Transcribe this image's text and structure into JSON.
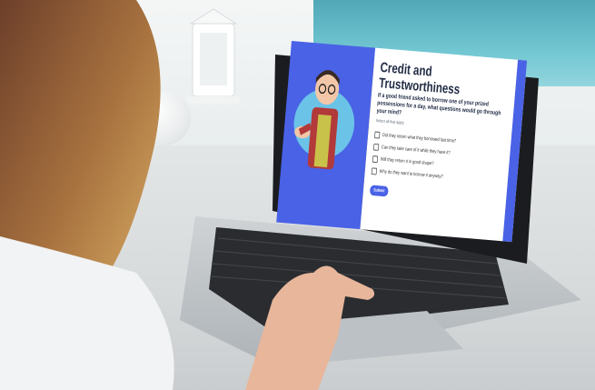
{
  "app": {
    "title": "Credit and Trustworthiness",
    "question": "If a good friend asked to borrow one of your prized possessions for a day, what questions would go through your mind?",
    "hint": "Select all that apply",
    "options": [
      "Did they return what they borrowed last time?",
      "Can they take care of it while they have it?",
      "Will they return it in good shape?",
      "Why do they want to borrow it anyway?"
    ],
    "submit_label": "Submit"
  },
  "colors": {
    "accent": "#4a62e6",
    "panel_bg": "#ffffff",
    "title_text": "#1f2a44"
  },
  "icons": {
    "illustration": "person-offering-hand-illustration",
    "checkbox": "checkbox-icon"
  }
}
